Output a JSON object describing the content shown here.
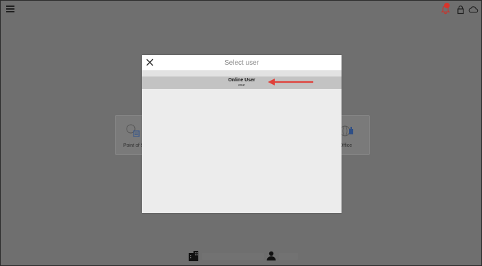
{
  "modal": {
    "title": "Select user",
    "users": [
      {
        "name": "Online User",
        "subtitle": "exur"
      }
    ]
  },
  "tiles": {
    "left_label": "Point of S",
    "right_label": "ck Office"
  },
  "icons": {
    "menu": "hamburger-menu-icon",
    "notifications": "bell-icon",
    "lock": "lock-icon",
    "cloud": "cloud-icon",
    "close": "close-icon",
    "annotation": "red-arrow"
  },
  "colors": {
    "overlay": "#6f6f6f",
    "modal_bg": "#ececec",
    "selected_row": "#c3c3c3",
    "annotation_arrow": "#e0403a",
    "badge": "#d9342b"
  }
}
